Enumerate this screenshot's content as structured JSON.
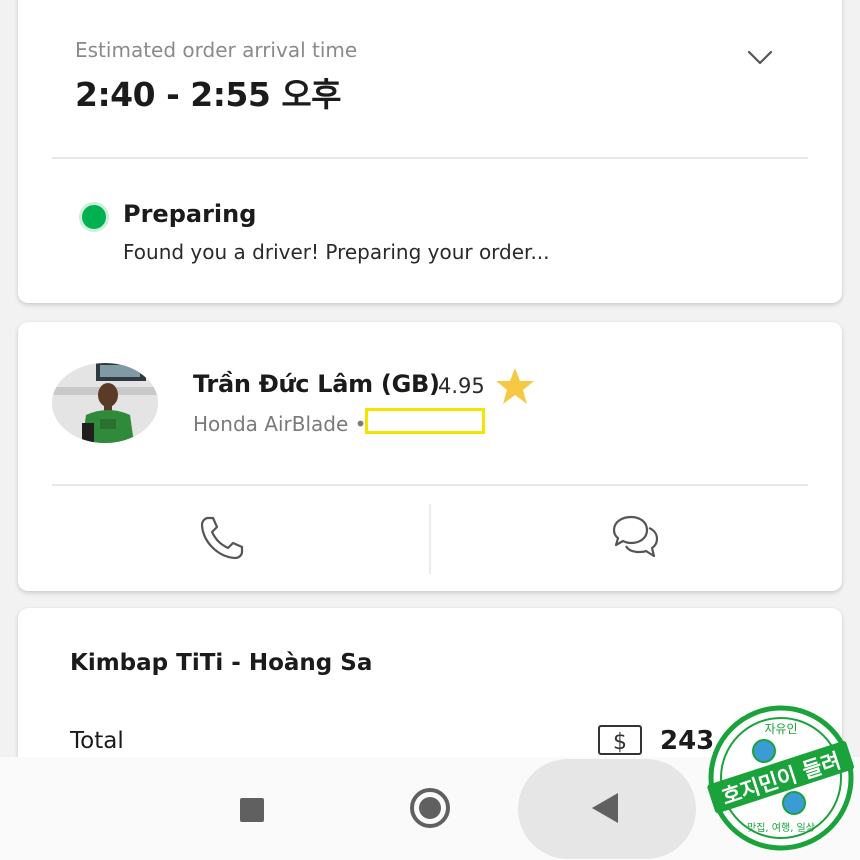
{
  "eta": {
    "label": "Estimated order arrival time",
    "time": "2:40 - 2:55 오후"
  },
  "status": {
    "title": "Preparing",
    "description": "Found you a driver! Preparing your order...",
    "color": "#00b14f"
  },
  "driver": {
    "name": "Trần Đức Lâm (GB)",
    "rating": "4.95",
    "vehicle": "Honda AirBlade •",
    "star_color": "#f6c843",
    "plate_highlight_color": "#f4e500"
  },
  "actions": {
    "call_icon": "phone-icon",
    "chat_icon": "chat-bubbles-icon"
  },
  "order": {
    "shop_name": "Kimbap TiTi -  Hoàng Sa",
    "total_label": "Total",
    "total_amount": "243.000 ₫"
  },
  "navbar": {
    "recents_icon": "square-icon",
    "home_icon": "circle-icon",
    "back_icon": "triangle-back-icon"
  },
  "watermark": {
    "top_text": "자유인",
    "main_text": "호지민이 들려",
    "bottom_text": "맛집, 여행, 일상",
    "color": "#1aa33a"
  }
}
